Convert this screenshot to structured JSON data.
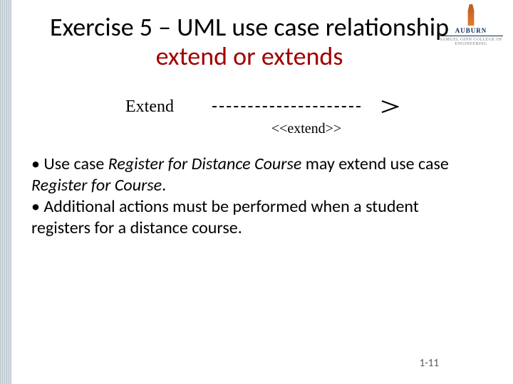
{
  "logo": {
    "name": "AUBURN",
    "sub": "SAMUEL GINN\nCOLLEGE OF ENGINEERING"
  },
  "title": {
    "part1": "Exercise 5 – UML use case relationship ",
    "part2": "extend or extends"
  },
  "notation": {
    "label": "Extend",
    "ext": "<<extend>>"
  },
  "bullets": {
    "b1_pre": "• Use case ",
    "b1_it1": "Register for Distance Course",
    "b1_mid": " may extend use case ",
    "b1_it2": "Register for Course",
    "b1_end": ".",
    "b2": "• Additional actions must be performed when a student registers for a distance course."
  },
  "page": "1-11"
}
